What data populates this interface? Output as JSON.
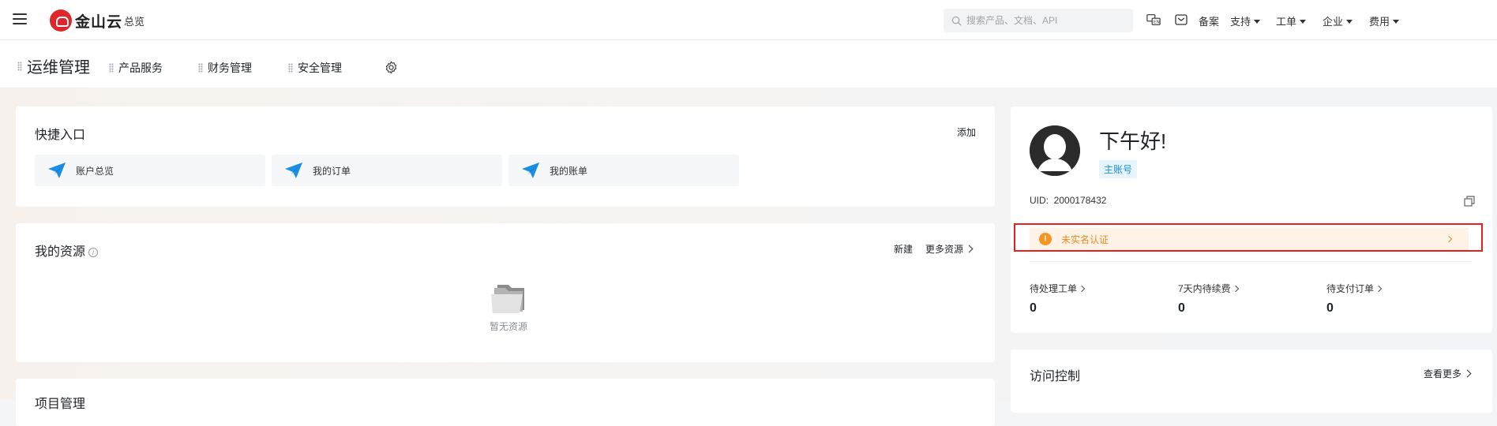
{
  "header": {
    "logo_text": "金山云",
    "overview": "总览",
    "search": {
      "placeholder": "搜索产品、文档、API"
    },
    "links": {
      "beian": "备案",
      "support": "支持",
      "ticket": "工单",
      "enterprise": "企业",
      "billing": "费用"
    }
  },
  "subnav": {
    "active": "运维管理",
    "items": [
      "产品服务",
      "财务管理",
      "安全管理"
    ]
  },
  "quick_entry": {
    "title": "快捷入口",
    "add": "添加",
    "items": [
      "账户总览",
      "我的订单",
      "我的账单"
    ]
  },
  "resources": {
    "title": "我的资源",
    "new": "新建",
    "more": "更多资源",
    "empty": "暂无资源"
  },
  "project": {
    "title": "项目管理"
  },
  "profile": {
    "greeting": "下午好!",
    "badge": "主账号",
    "uid_label": "UID:",
    "uid_value": "2000178432",
    "alert": "未实名认证",
    "stats": [
      {
        "label": "待处理工单",
        "value": "0"
      },
      {
        "label": "7天内待续费",
        "value": "0"
      },
      {
        "label": "待支付订单",
        "value": "0"
      }
    ]
  },
  "access_control": {
    "title": "访问控制",
    "more": "查看更多"
  },
  "colors": {
    "brand": "#e0262b",
    "alert_border": "#e5211d",
    "alert_bg": "#fef3e6",
    "warning": "#f5951f",
    "badge": "#1a8fe3",
    "plane_icon": "#1a8fe3"
  }
}
